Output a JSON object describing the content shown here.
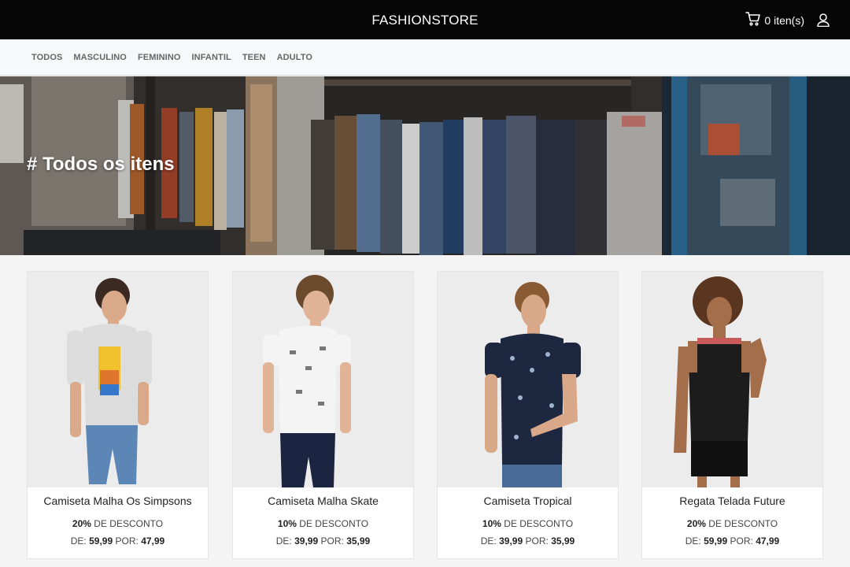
{
  "header": {
    "brand": "FASHIONSTORE",
    "cart_label": "0 iten(s)"
  },
  "categories": [
    {
      "label": "TODOS"
    },
    {
      "label": "MASCULINO"
    },
    {
      "label": "FEMININO"
    },
    {
      "label": "INFANTIL"
    },
    {
      "label": "TEEN"
    },
    {
      "label": "ADULTO"
    }
  ],
  "hero": {
    "title": "# Todos os itens"
  },
  "labels": {
    "discount_suffix": "DE DESCONTO",
    "price_from": "DE:",
    "price_to": "POR:"
  },
  "products": [
    {
      "name": "Camiseta Malha Os Simpsons",
      "discount": "20%",
      "old_price": "59,99",
      "new_price": "47,99"
    },
    {
      "name": "Camiseta Malha Skate",
      "discount": "10%",
      "old_price": "39,99",
      "new_price": "35,99"
    },
    {
      "name": "Camiseta Tropical",
      "discount": "10%",
      "old_price": "39,99",
      "new_price": "35,99"
    },
    {
      "name": "Regata Telada Future",
      "discount": "20%",
      "old_price": "59,99",
      "new_price": "47,99"
    }
  ],
  "icons": {
    "cart": "shopping-cart-icon",
    "user": "user-icon"
  }
}
